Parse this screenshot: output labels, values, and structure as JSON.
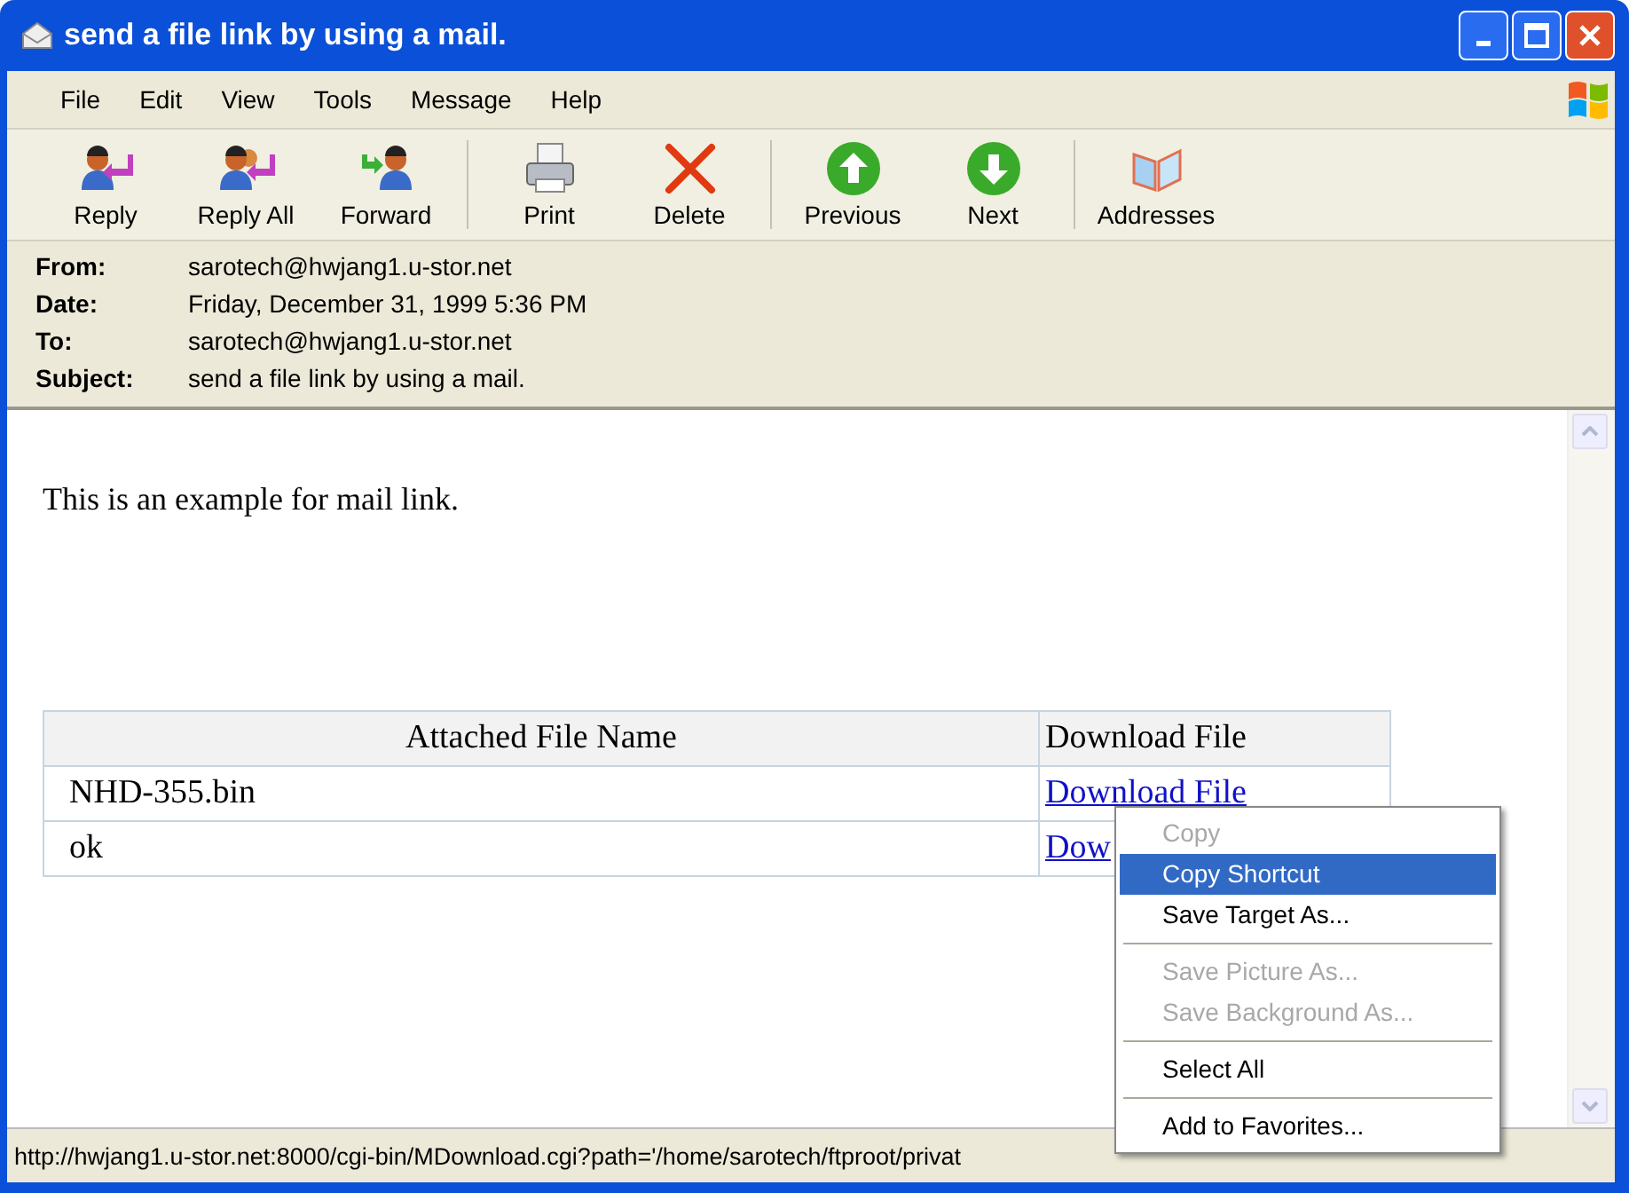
{
  "window": {
    "title": "send a file link by using a mail."
  },
  "menu_bar": [
    "File",
    "Edit",
    "View",
    "Tools",
    "Message",
    "Help"
  ],
  "toolbar": [
    [
      {
        "label": "Reply",
        "kind": "reply"
      },
      {
        "label": "Reply All",
        "kind": "replyall"
      },
      {
        "label": "Forward",
        "kind": "forward"
      }
    ],
    [
      {
        "label": "Print",
        "kind": "print"
      },
      {
        "label": "Delete",
        "kind": "delete"
      }
    ],
    [
      {
        "label": "Previous",
        "kind": "up"
      },
      {
        "label": "Next",
        "kind": "down"
      }
    ],
    [
      {
        "label": "Addresses",
        "kind": "book"
      }
    ]
  ],
  "header": [
    {
      "label": "From:",
      "value": "sarotech@hwjang1.u-stor.net"
    },
    {
      "label": "Date:",
      "value": "Friday, December 31, 1999 5:36 PM"
    },
    {
      "label": "To:",
      "value": "sarotech@hwjang1.u-stor.net"
    },
    {
      "label": "Subject:",
      "value": "send a file link by using a mail."
    }
  ],
  "body": {
    "text": "This is an example for mail link.",
    "table": {
      "columns": [
        "Attached File Name",
        "Download File"
      ],
      "rows": [
        {
          "name": "NHD-355.bin",
          "link": "Download File"
        },
        {
          "name": "ok",
          "link": "Dow"
        }
      ]
    }
  },
  "context_menu": [
    [
      {
        "label": "Copy",
        "disabled": true,
        "selected": false
      },
      {
        "label": "Copy Shortcut",
        "disabled": false,
        "selected": true
      },
      {
        "label": "Save Target As...",
        "disabled": false,
        "selected": false
      }
    ],
    [
      {
        "label": "Save Picture As...",
        "disabled": true,
        "selected": false
      },
      {
        "label": "Save Background As...",
        "disabled": true,
        "selected": false
      }
    ],
    [
      {
        "label": "Select All",
        "disabled": false,
        "selected": false
      }
    ],
    [
      {
        "label": "Add to Favorites...",
        "disabled": false,
        "selected": false
      }
    ]
  ],
  "status_bar": "http://hwjang1.u-stor.net:8000/cgi-bin/MDownload.cgi?path='/home/sarotech/ftproot/privat"
}
